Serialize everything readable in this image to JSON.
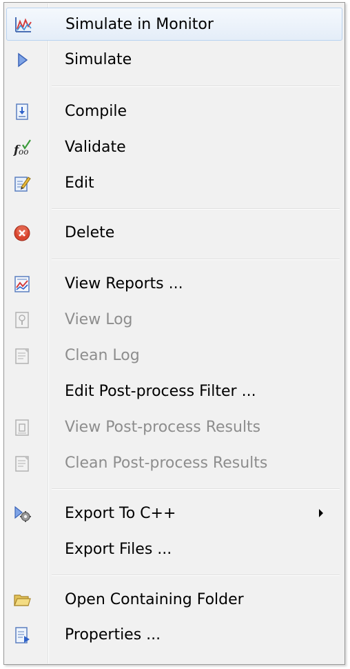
{
  "menu": {
    "items": [
      {
        "label": "Simulate in Monitor",
        "icon": "simulate-monitor-icon",
        "enabled": true,
        "highlighted": true
      },
      {
        "label": "Simulate",
        "icon": "play-icon",
        "enabled": true
      },
      {
        "label": "Compile",
        "icon": "compile-icon",
        "enabled": true
      },
      {
        "label": "Validate",
        "icon": "validate-fx-icon",
        "enabled": true
      },
      {
        "label": "Edit",
        "icon": "edit-icon",
        "enabled": true
      },
      {
        "label": "Delete",
        "icon": "delete-icon",
        "enabled": true
      },
      {
        "label": "View Reports ...",
        "icon": "reports-chart-icon",
        "enabled": true
      },
      {
        "label": "View Log",
        "icon": "view-log-icon",
        "enabled": false
      },
      {
        "label": "Clean Log",
        "icon": "clean-log-icon",
        "enabled": false
      },
      {
        "label": "Edit Post-process Filter ...",
        "icon": "",
        "enabled": true
      },
      {
        "label": "View Post-process Results",
        "icon": "view-results-icon",
        "enabled": false
      },
      {
        "label": "Clean Post-process Results",
        "icon": "clean-results-icon",
        "enabled": false
      },
      {
        "label": "Export To C++",
        "icon": "export-gear-icon",
        "enabled": true,
        "submenu": true
      },
      {
        "label": "Export Files ...",
        "icon": "",
        "enabled": true
      },
      {
        "label": "Open Containing Folder",
        "icon": "folder-icon",
        "enabled": true
      },
      {
        "label": "Properties ...",
        "icon": "properties-icon",
        "enabled": true
      }
    ]
  },
  "colors": {
    "highlight_border": "#b8d2f0",
    "disabled_text": "#8d8d8d",
    "delete_red": "#d9462f"
  }
}
